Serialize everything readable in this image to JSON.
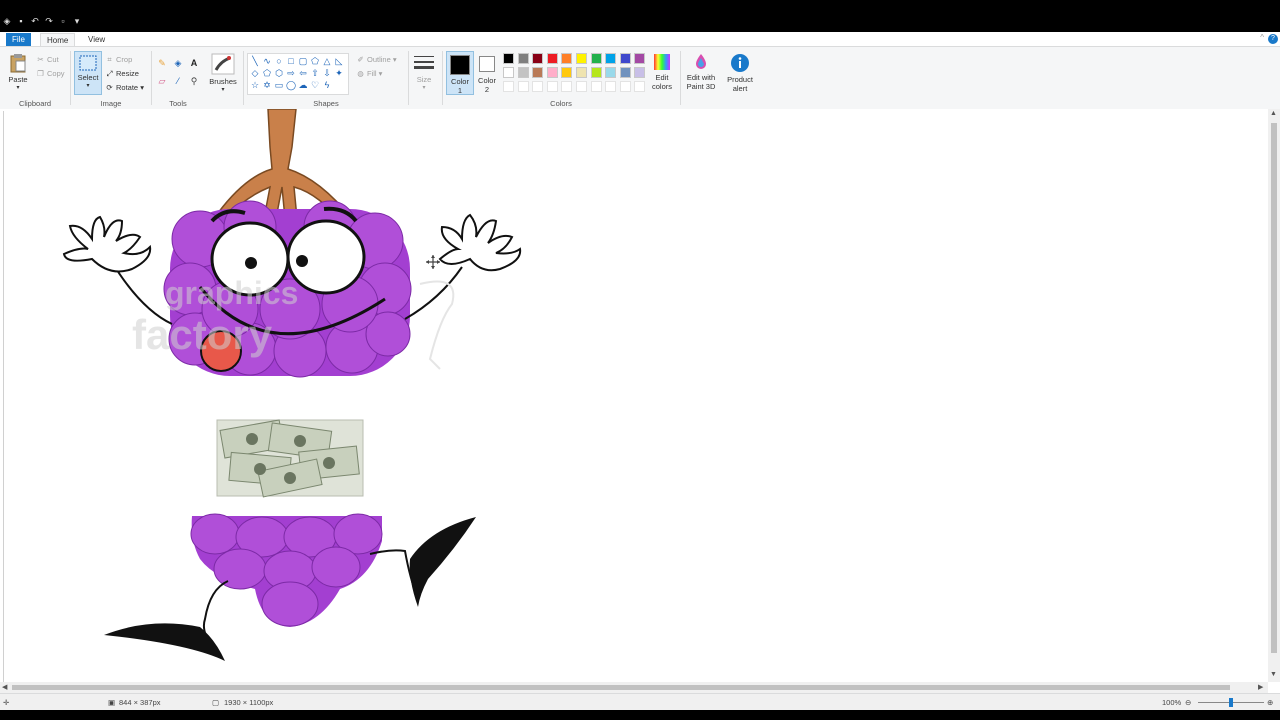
{
  "tabs": {
    "file": "File",
    "home": "Home",
    "view": "View"
  },
  "clipboard": {
    "paste": "Paste",
    "cut": "Cut",
    "copy": "Copy",
    "label": "Clipboard"
  },
  "image": {
    "select": "Select",
    "crop": "Crop",
    "resize": "Resize",
    "rotate": "Rotate",
    "label": "Image"
  },
  "tools": {
    "label": "Tools"
  },
  "brushes": {
    "label": "Brushes"
  },
  "shapes": {
    "outline": "Outline",
    "fill": "Fill",
    "label": "Shapes"
  },
  "size": {
    "label": "Size"
  },
  "colors": {
    "color1": "Color 1",
    "color2": "Color 2",
    "edit_colors": "Edit colors",
    "paint3d": "Edit with Paint 3D",
    "product_alert": "Product alert",
    "label": "Colors",
    "active_color1": "#000000",
    "active_color2": "#ffffff",
    "palette_row1": [
      "#000000",
      "#7f7f7f",
      "#880015",
      "#ed1c24",
      "#ff7f27",
      "#fff200",
      "#22b14c",
      "#00a2e8",
      "#3f48cc",
      "#a349a4"
    ],
    "palette_row2": [
      "#ffffff",
      "#c3c3c3",
      "#b97a57",
      "#ffaec9",
      "#ffc90e",
      "#efe4b0",
      "#b5e61d",
      "#99d9ea",
      "#7092be",
      "#c8bfe7"
    ]
  },
  "canvas": {
    "watermark_line1": "graphics",
    "watermark_line2": "factory"
  },
  "status": {
    "selection_size": "844 × 387px",
    "image_size": "1930 × 1100px",
    "zoom": "100%"
  }
}
